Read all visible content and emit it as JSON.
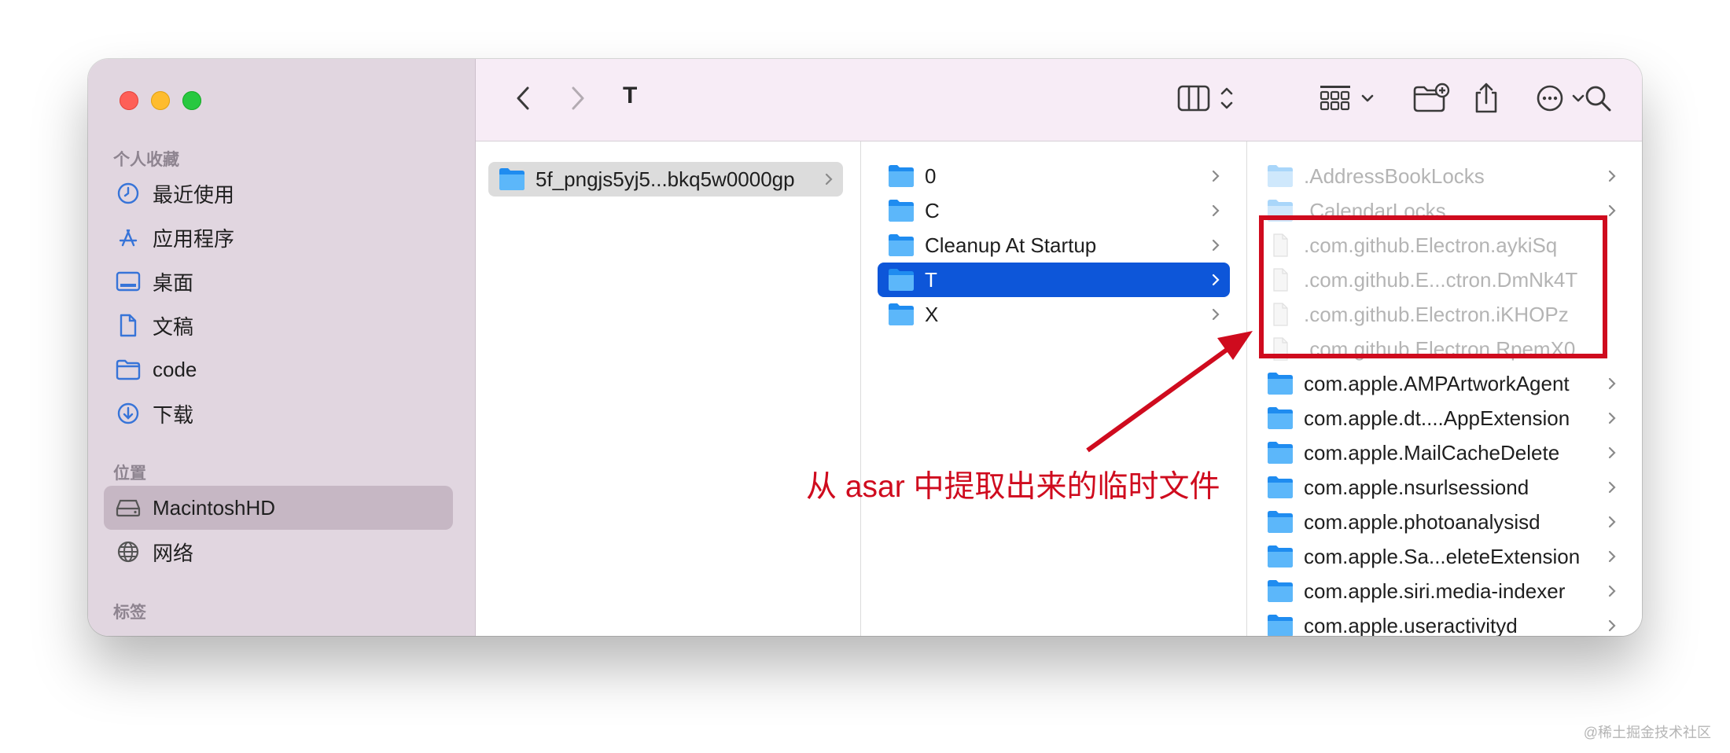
{
  "window": {
    "title": "T"
  },
  "sidebar": {
    "favorites_title": "个人收藏",
    "favorites": [
      {
        "label": "最近使用",
        "icon": "clock-icon"
      },
      {
        "label": "应用程序",
        "icon": "applications-icon"
      },
      {
        "label": "桌面",
        "icon": "desktop-icon"
      },
      {
        "label": "文稿",
        "icon": "document-icon"
      },
      {
        "label": "code",
        "icon": "folder-icon"
      },
      {
        "label": "下载",
        "icon": "download-icon"
      }
    ],
    "locations_title": "位置",
    "locations": [
      {
        "label": "MacintoshHD",
        "icon": "drive-icon",
        "selected": true
      },
      {
        "label": "网络",
        "icon": "network-icon"
      }
    ],
    "tags_title": "标签"
  },
  "toolbar": {
    "back": "chevron-left-icon",
    "forward": "chevron-right-icon",
    "view_toggle": "columns-view-icon",
    "group": "grid-group-icon",
    "new_folder": "new-folder-icon",
    "share": "share-icon",
    "more": "more-icon",
    "search": "search-icon"
  },
  "columns": {
    "col1": [
      {
        "label": "5f_pngjs5yj5...bkq5w0000gp",
        "selected": "gray"
      }
    ],
    "col2": [
      {
        "label": "0"
      },
      {
        "label": "C"
      },
      {
        "label": "Cleanup At Startup"
      },
      {
        "label": "T",
        "selected": "blue"
      },
      {
        "label": "X"
      }
    ],
    "col3": [
      {
        "label": ".AddressBookLocks",
        "type": "folder",
        "dim": true
      },
      {
        "label": ".CalendarLocks",
        "type": "folder",
        "dim": true
      },
      {
        "label": ".com.github.Electron.aykiSq",
        "type": "file",
        "dim": true
      },
      {
        "label": ".com.github.E...ctron.DmNk4T",
        "type": "file",
        "dim": true
      },
      {
        "label": ".com.github.Electron.iKHOPz",
        "type": "file",
        "dim": true
      },
      {
        "label": ".com.github.Electron.RpemX0",
        "type": "file",
        "dim": true
      },
      {
        "label": "com.apple.AMPArtworkAgent",
        "type": "folder"
      },
      {
        "label": "com.apple.dt....AppExtension",
        "type": "folder"
      },
      {
        "label": "com.apple.MailCacheDelete",
        "type": "folder"
      },
      {
        "label": "com.apple.nsurlsessiond",
        "type": "folder"
      },
      {
        "label": "com.apple.photoanalysisd",
        "type": "folder"
      },
      {
        "label": "com.apple.Sa...eleteExtension",
        "type": "folder"
      },
      {
        "label": "com.apple.siri.media-indexer",
        "type": "folder"
      },
      {
        "label": "com.apple.useractivityd",
        "type": "folder"
      }
    ]
  },
  "annotation": {
    "text": "从 asar 中提取出来的临时文件",
    "color": "#cf0b1e"
  },
  "watermark": "@稀土掘金技术社区"
}
